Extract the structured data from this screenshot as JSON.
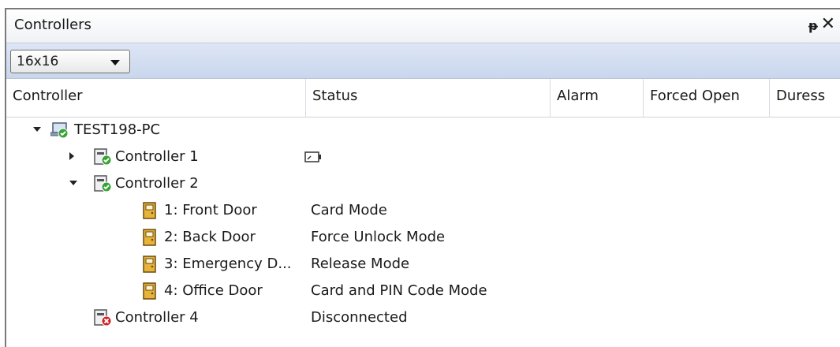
{
  "panel": {
    "title": "Controllers",
    "pin_glyph": "ᵽ",
    "close_glyph": "✕"
  },
  "toolbar": {
    "size_value": "16x16"
  },
  "columns": [
    "Controller",
    "Status",
    "Alarm",
    "Forced Open",
    "Duress"
  ],
  "rows": [
    {
      "label": "TEST198-PC",
      "status": "",
      "icon": "pc-connected-icon",
      "toggle": "expanded"
    },
    {
      "label": "Controller 1",
      "status": "",
      "icon": "controller-connected-icon",
      "toggle": "collapsed",
      "status_icon": "battery-icon"
    },
    {
      "label": "Controller 2",
      "status": "",
      "icon": "controller-connected-icon",
      "toggle": "expanded"
    },
    {
      "label": "1: Front Door",
      "status": "Card Mode",
      "icon": "door-icon"
    },
    {
      "label": "2: Back Door",
      "status": "Force Unlock Mode",
      "icon": "door-icon"
    },
    {
      "label": "3: Emergency D...",
      "status": "Release Mode",
      "icon": "door-icon"
    },
    {
      "label": "4: Office Door",
      "status": "Card and PIN Code Mode",
      "icon": "door-icon"
    },
    {
      "label": "Controller 4",
      "status": "Disconnected",
      "icon": "controller-disconnected-icon"
    }
  ],
  "colors": {
    "ok": "#35a335",
    "error": "#d32020",
    "door": "#e7b43a"
  }
}
